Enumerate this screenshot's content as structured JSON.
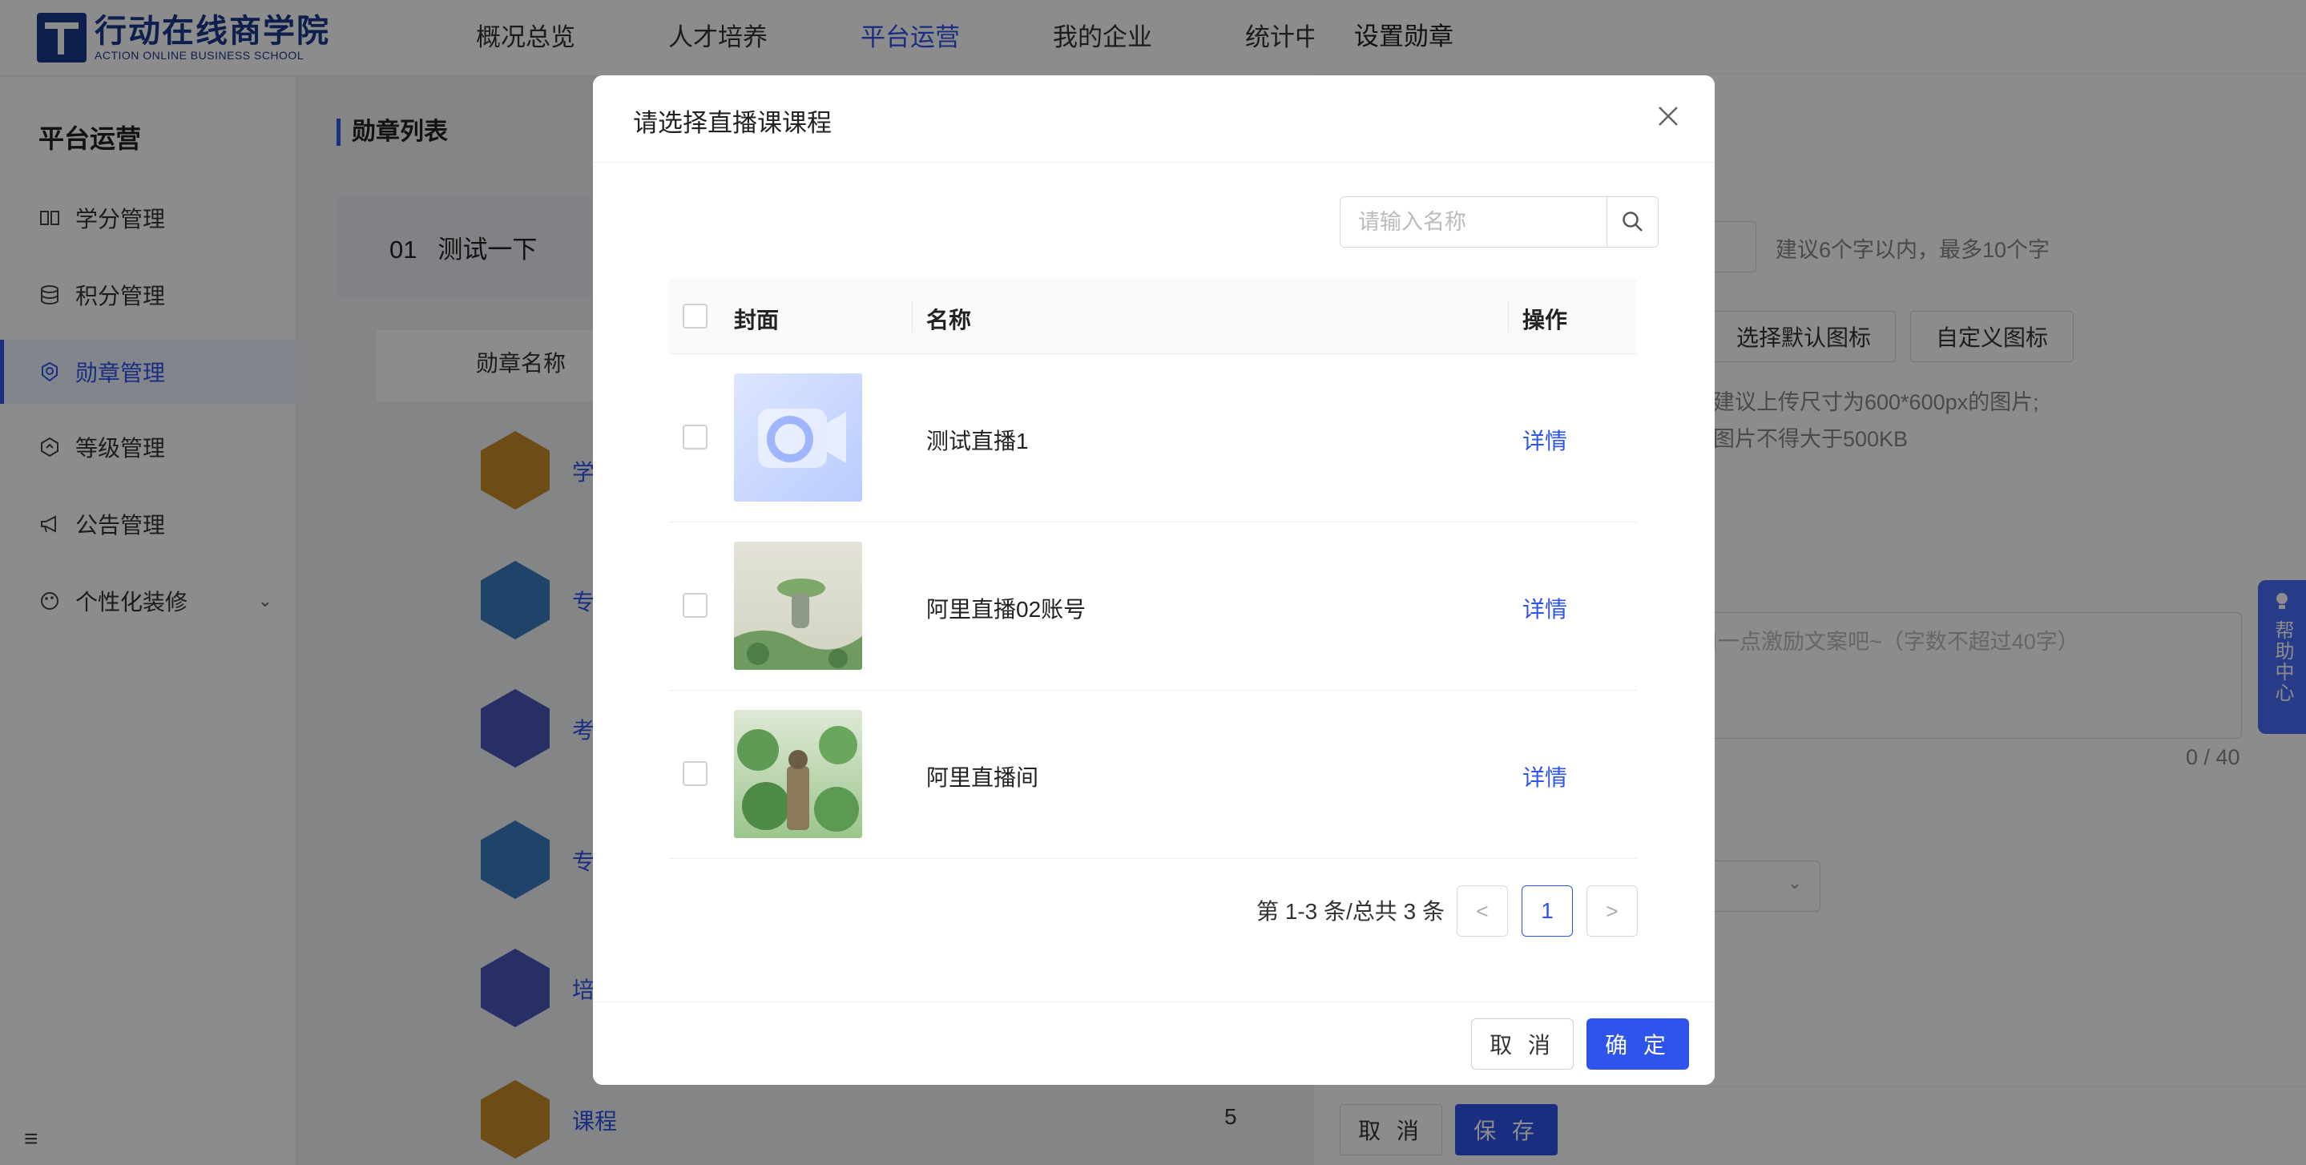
{
  "brand": {
    "name_cn": "行动在线商学院",
    "name_en": "ACTION ONLINE BUSINESS SCHOOL"
  },
  "top_nav": [
    {
      "label": "概况总览",
      "active": false
    },
    {
      "label": "人才培养",
      "active": false
    },
    {
      "label": "平台运营",
      "active": true
    },
    {
      "label": "我的企业",
      "active": false
    },
    {
      "label": "统计中",
      "active": false
    }
  ],
  "sidebar": {
    "title": "平台运营",
    "items": [
      {
        "label": "学分管理",
        "icon": "book-icon"
      },
      {
        "label": "积分管理",
        "icon": "database-icon"
      },
      {
        "label": "勋章管理",
        "icon": "medal-icon",
        "active": true
      },
      {
        "label": "等级管理",
        "icon": "level-icon"
      },
      {
        "label": "公告管理",
        "icon": "megaphone-icon"
      },
      {
        "label": "个性化装修",
        "icon": "palette-icon",
        "expandable": true
      }
    ]
  },
  "content": {
    "breadcrumb": "勋章列表",
    "group": {
      "index": "01",
      "name": "测试一下"
    },
    "column_header": "勋章名称",
    "rows": [
      {
        "name": "学",
        "color": "#c98a2a"
      },
      {
        "name": "专",
        "color": "#3a7bbf"
      },
      {
        "name": "考",
        "color": "#4a56b8"
      },
      {
        "name": "专",
        "color": "#3a7bbf"
      },
      {
        "name": "培",
        "color": "#4a56b8"
      },
      {
        "name": "课程",
        "color": "#c98a2a",
        "count": "5"
      }
    ]
  },
  "drawer": {
    "title": "设置勋章",
    "name_hint": "建议6个字以内，最多10个字",
    "icon_buttons": [
      "选择默认图标",
      "自定义图标"
    ],
    "upload_hint_1": "建议上传尺寸为600*600px的图片;",
    "upload_hint_2": "图片不得大于500KB",
    "textarea_placeholder": "口一点激励文案吧~（字数不超过40字）",
    "counter": "0 / 40",
    "cancel_label": "取 消",
    "save_label": "保 存",
    "help_label": "帮助中心"
  },
  "modal": {
    "title": "请选择直播课课程",
    "search_placeholder": "请输入名称",
    "columns": {
      "cover": "封面",
      "name": "名称",
      "action": "操作"
    },
    "rows": [
      {
        "name": "测试直播1",
        "action": "详情",
        "cover": "blue-play-icon"
      },
      {
        "name": "阿里直播02账号",
        "action": "详情",
        "cover": "rain-illustration"
      },
      {
        "name": "阿里直播间",
        "action": "详情",
        "cover": "lotus-illustration"
      }
    ],
    "pagination": {
      "summary": "第 1-3 条/总共 3 条",
      "current": "1"
    },
    "cancel_label": "取 消",
    "ok_label": "确 定",
    "accent": "#2f54eb"
  }
}
